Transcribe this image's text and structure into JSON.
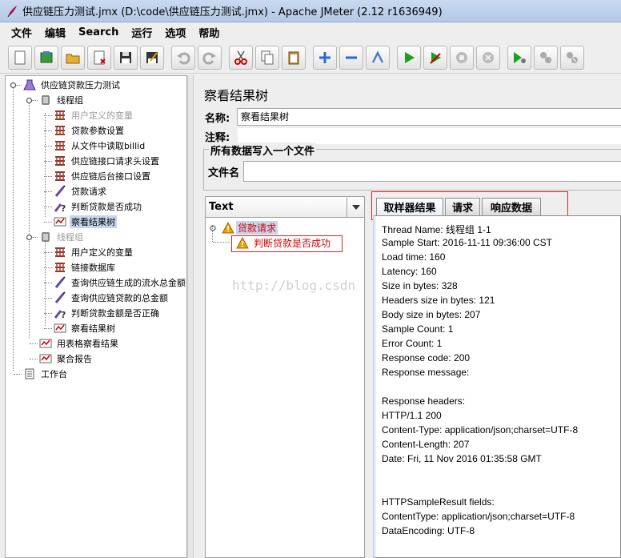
{
  "window": {
    "title": "供应链压力测试.jmx (D:\\code\\供应链压力测试.jmx) - Apache JMeter (2.12 r1636949)"
  },
  "menu": [
    "文件",
    "编辑",
    "Search",
    "运行",
    "选项",
    "帮助"
  ],
  "toolbar": [
    {
      "name": "new-icon"
    },
    {
      "name": "templates-icon"
    },
    {
      "name": "open-icon"
    },
    {
      "name": "close-file-icon"
    },
    {
      "name": "save-icon"
    },
    {
      "name": "save-as-icon"
    },
    {
      "name": "undo-icon"
    },
    {
      "name": "redo-icon"
    },
    {
      "name": "cut-icon"
    },
    {
      "name": "copy-icon"
    },
    {
      "name": "paste-icon"
    },
    {
      "name": "expand-icon"
    },
    {
      "name": "collapse-icon"
    },
    {
      "name": "toggle-icon"
    },
    {
      "name": "start-icon"
    },
    {
      "name": "start-no-pause-icon"
    },
    {
      "name": "stop-icon"
    },
    {
      "name": "shutdown-icon"
    },
    {
      "name": "remote-start-icon"
    },
    {
      "name": "remote-stop-icon"
    },
    {
      "name": "remote-shutdown-icon"
    }
  ],
  "tree": {
    "items": [
      {
        "label": "供应链贷款压力测试",
        "icon": "testplan",
        "disabled": false,
        "selected": false
      },
      {
        "label": "线程组",
        "icon": "threadgroup",
        "disabled": false,
        "selected": false
      },
      {
        "label": "用户定义的变量",
        "icon": "config",
        "disabled": true,
        "selected": false
      },
      {
        "label": "贷款参数设置",
        "icon": "config",
        "disabled": false,
        "selected": false
      },
      {
        "label": "从文件中读取billid",
        "icon": "config",
        "disabled": false,
        "selected": false
      },
      {
        "label": "供应链接口请求头设置",
        "icon": "config",
        "disabled": false,
        "selected": false
      },
      {
        "label": "供应链后台接口设置",
        "icon": "config",
        "disabled": false,
        "selected": false
      },
      {
        "label": "贷款请求",
        "icon": "sampler",
        "disabled": false,
        "selected": false
      },
      {
        "label": "判断贷款是否成功",
        "icon": "assertion",
        "disabled": false,
        "selected": false
      },
      {
        "label": "察看结果树",
        "icon": "listener",
        "disabled": false,
        "selected": true
      },
      {
        "label": "线程组",
        "icon": "threadgroup",
        "disabled": true,
        "selected": false
      },
      {
        "label": "用户定义的变量",
        "icon": "config",
        "disabled": false,
        "selected": false
      },
      {
        "label": "链接数据库",
        "icon": "config",
        "disabled": false,
        "selected": false
      },
      {
        "label": "查询供应链生成的流水总金额",
        "icon": "sampler",
        "disabled": false,
        "selected": false
      },
      {
        "label": "查询供应链贷款的总金额",
        "icon": "sampler",
        "disabled": false,
        "selected": false
      },
      {
        "label": "判断贷款金额是否正确",
        "icon": "assertion",
        "disabled": false,
        "selected": false
      },
      {
        "label": "察看结果树",
        "icon": "listener",
        "disabled": false,
        "selected": false
      },
      {
        "label": "用表格察看结果",
        "icon": "listener",
        "disabled": false,
        "selected": false
      },
      {
        "label": "聚合报告",
        "icon": "listener",
        "disabled": false,
        "selected": false
      },
      {
        "label": "工作台",
        "icon": "workbench",
        "disabled": false,
        "selected": false
      }
    ]
  },
  "panel": {
    "title": "察看结果树",
    "name_label": "名称:",
    "name_value": "察看结果树",
    "comment_label": "注释:",
    "comment_value": "",
    "group_title": "所有数据写入一个文件",
    "file_label": "文件名",
    "file_value": ""
  },
  "results": {
    "renderer": "Text",
    "sample": "贷款请求",
    "assertion": "判断贷款是否成功"
  },
  "tabs": [
    "取样器结果",
    "请求",
    "响应数据"
  ],
  "sampler_result": [
    "Thread Name: 线程组 1-1",
    "Sample Start: 2016-11-11 09:36:00 CST",
    "Load time: 160",
    "Latency: 160",
    "Size in bytes: 328",
    "Headers size in bytes: 121",
    "Body size in bytes: 207",
    "Sample Count: 1",
    "Error Count: 1",
    "Response code: 200",
    "Response message:",
    "",
    "Response headers:",
    "HTTP/1.1 200",
    "Content-Type: application/json;charset=UTF-8",
    "Content-Length: 207",
    "Date: Fri, 11 Nov 2016 01:35:58 GMT",
    "",
    "",
    "HTTPSampleResult fields:",
    "ContentType: application/json;charset=UTF-8",
    "DataEncoding: UTF-8"
  ],
  "watermark": "http://blog.csdn",
  "colors": {
    "error": "#d20000",
    "selection": "#c6d6ec",
    "annotation": "#e02020"
  }
}
